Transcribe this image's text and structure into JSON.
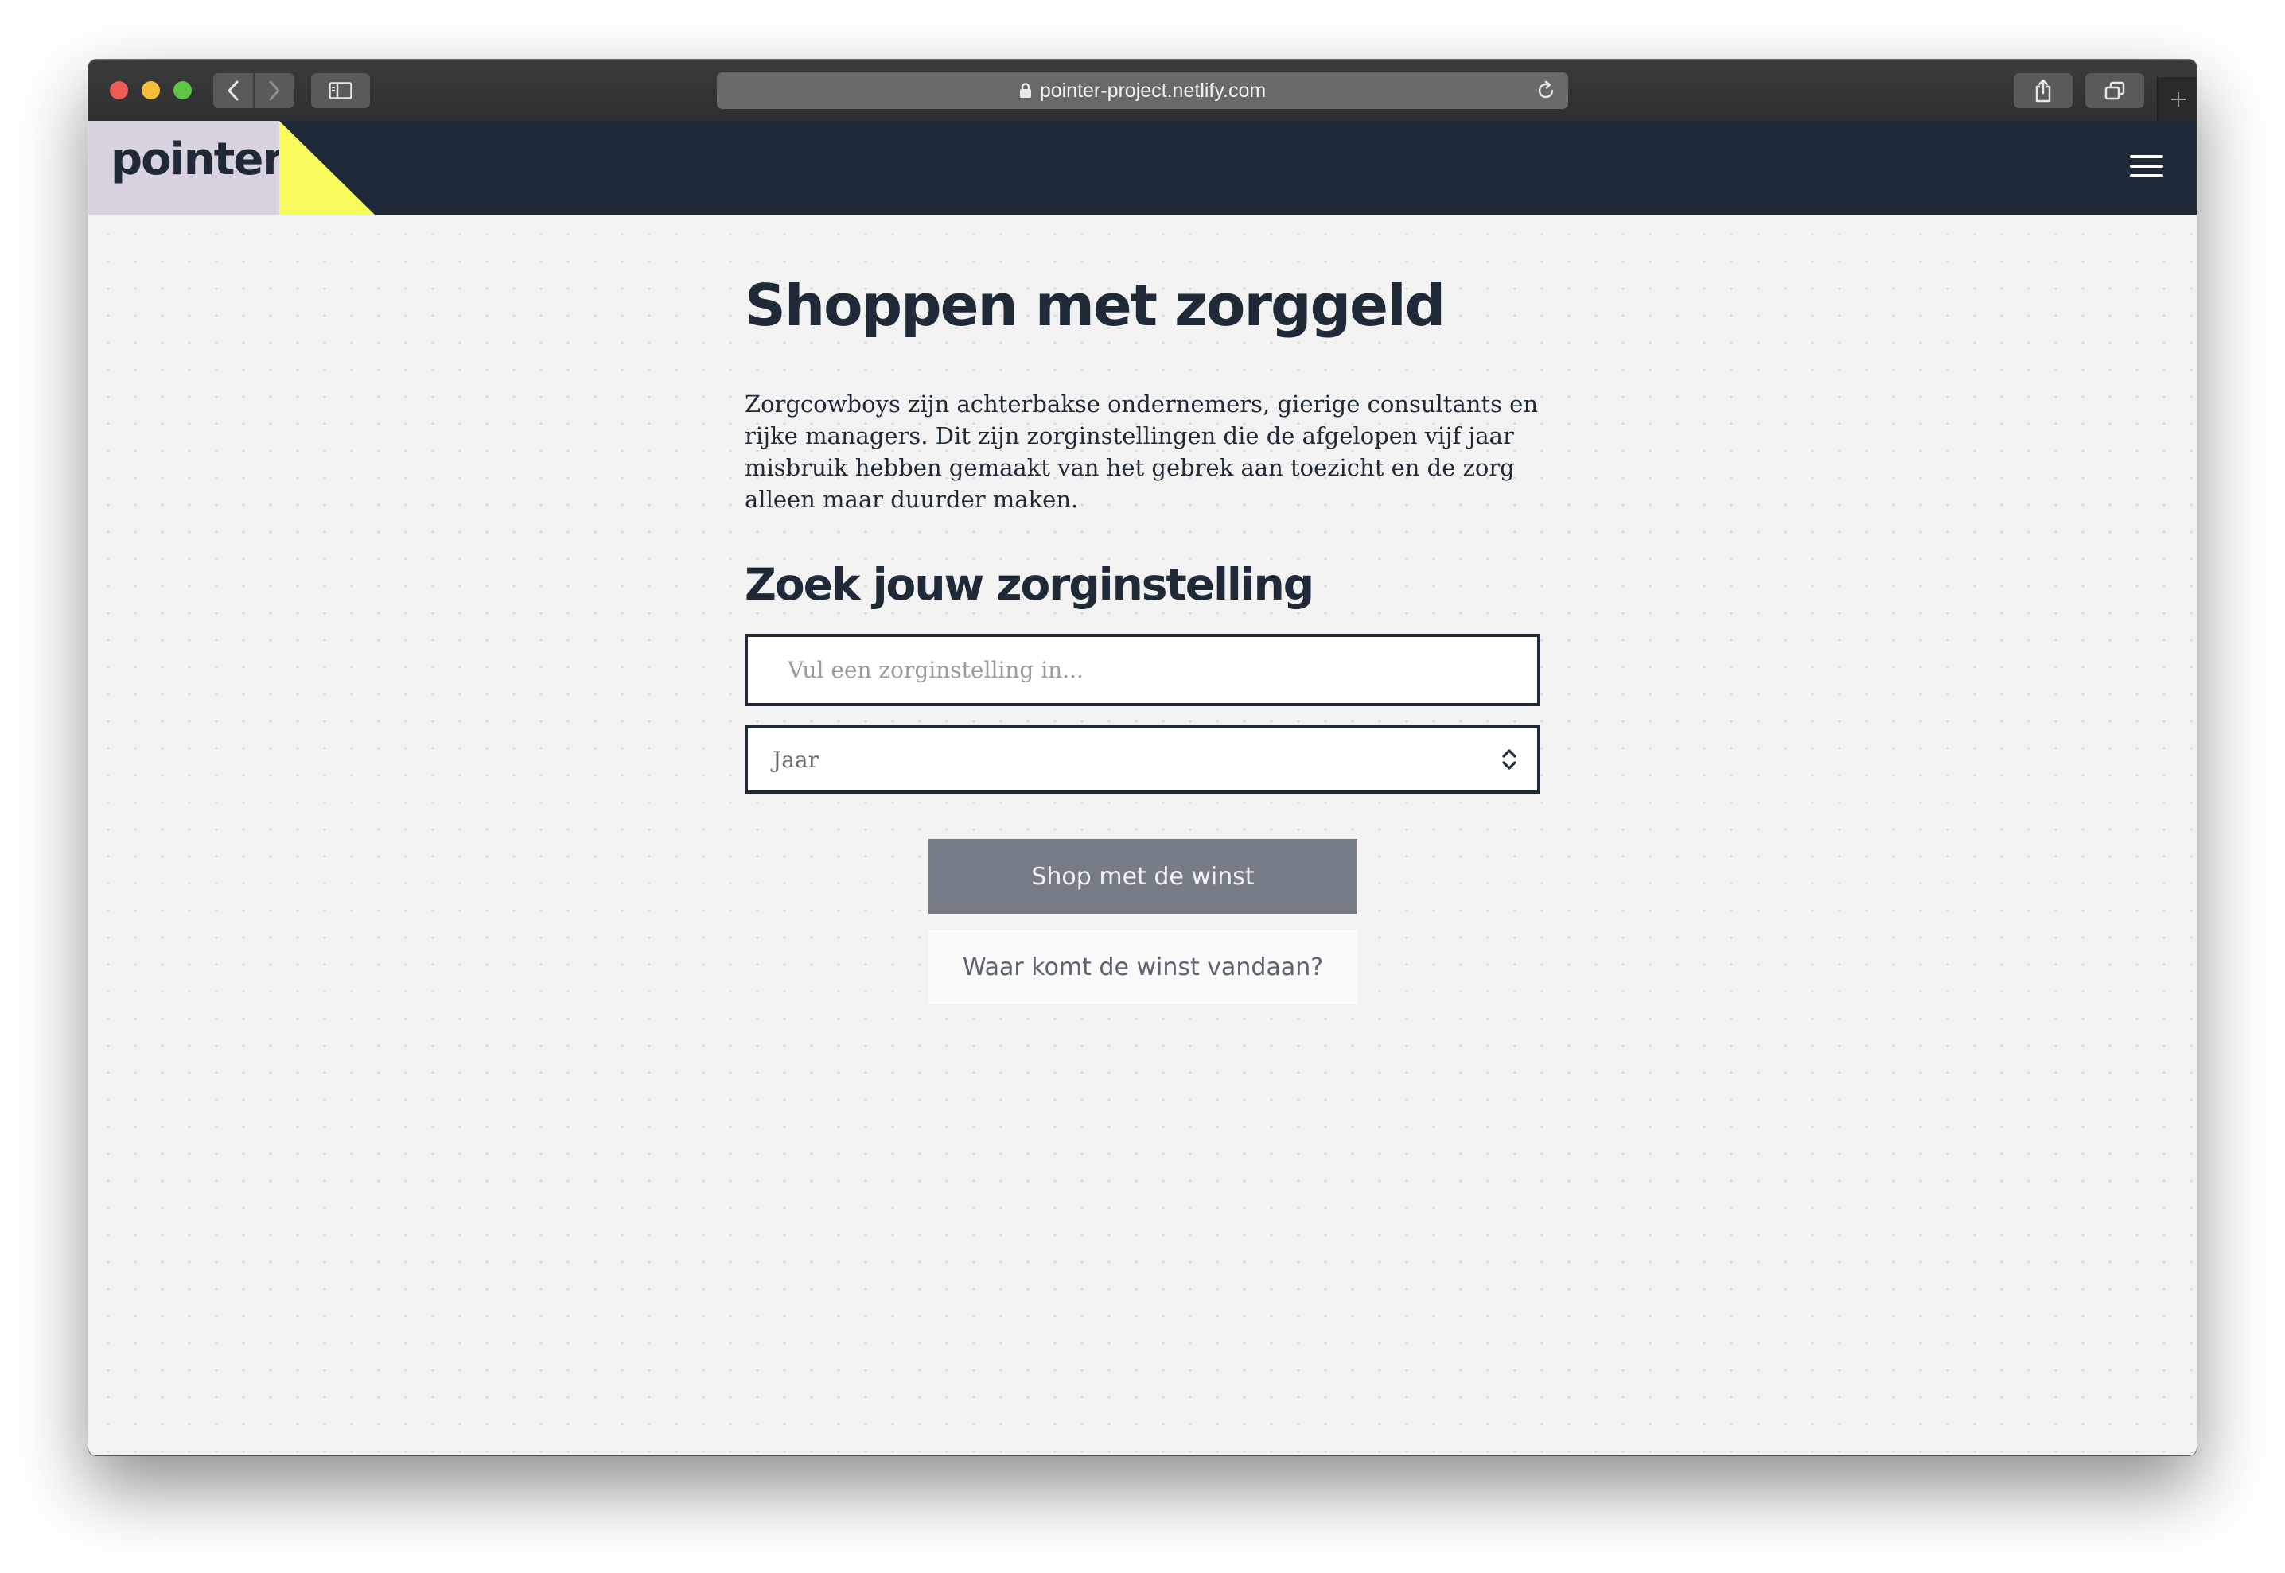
{
  "browser": {
    "url": "pointer-project.netlify.com"
  },
  "site": {
    "logo": "pointer",
    "accent_color": "#f7fc5c",
    "header_color": "#1f2937",
    "logo_bg_color": "#d9d2df"
  },
  "main": {
    "title": "Shoppen met zorggeld",
    "intro": "Zorgcowboys zijn achterbakse ondernemers, gierige consultants en rijke managers. Dit zijn zorginstellingen die de afgelopen vijf jaar misbruik hebben gemaakt van het gebrek aan toezicht en de zorg alleen maar duurder maken.",
    "search_heading": "Zoek jouw zorginstelling",
    "search": {
      "placeholder": "Vul een zorginstelling in...",
      "value": ""
    },
    "year_select": {
      "selected": "Jaar"
    },
    "shop_button": "Shop met de winst",
    "winst_button": "Waar komt de winst vandaan?"
  }
}
